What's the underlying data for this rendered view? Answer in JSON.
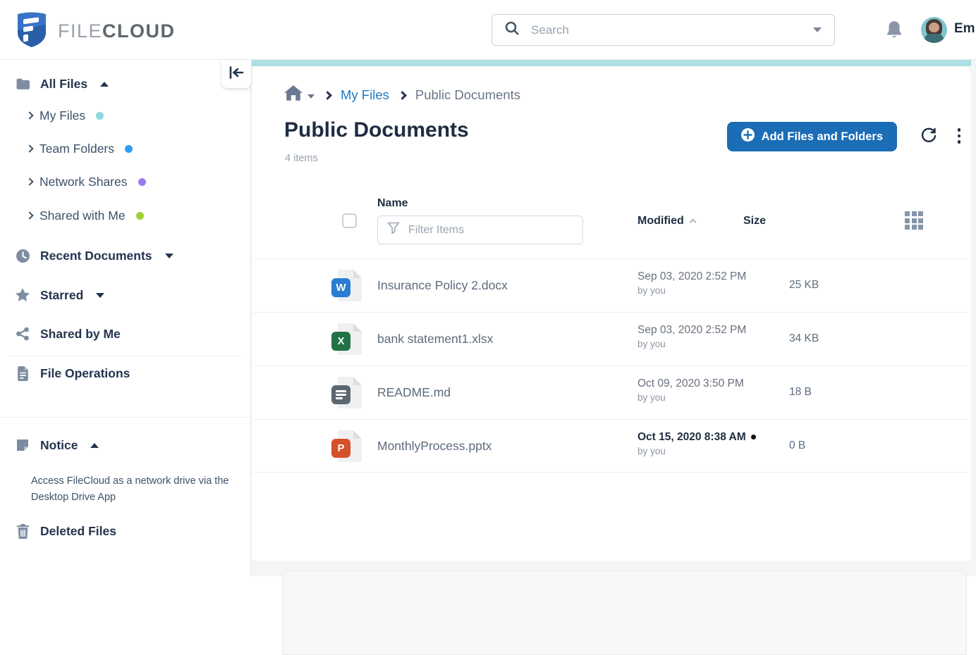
{
  "brand": {
    "file": "FILE",
    "cloud": "CLOUD"
  },
  "header": {
    "search_placeholder": "Search",
    "user_name": "Em"
  },
  "sidebar": {
    "all_files": "All Files",
    "sub_items": [
      {
        "label": "My Files",
        "dot_color": "#8fd8df"
      },
      {
        "label": "Team Folders",
        "dot_color": "#2d9cf4"
      },
      {
        "label": "Network Shares",
        "dot_color": "#9b79f1"
      },
      {
        "label": "Shared with Me",
        "dot_color": "#a6cd38"
      }
    ],
    "recent_documents": "Recent Documents",
    "starred": "Starred",
    "shared_by_me": "Shared by Me",
    "file_operations": "File Operations",
    "notice": "Notice",
    "notice_text": "Access FileCloud as a network drive via the Desktop Drive App",
    "deleted_files": "Deleted Files"
  },
  "breadcrumb": {
    "my_files": "My Files",
    "current": "Public Documents"
  },
  "page": {
    "title": "Public Documents",
    "item_count": "4 items",
    "add_button": "Add Files and Folders"
  },
  "table": {
    "name_header": "Name",
    "filter_placeholder": "Filter Items",
    "modified_header": "Modified",
    "size_header": "Size",
    "rows": [
      {
        "name": "Insurance Policy 2.docx",
        "file_type": "word",
        "badge_letter": "W",
        "badge_color": "#2b7cd3",
        "modified_date": "Sep 03, 2020 2:52 PM",
        "modified_by": "by you",
        "size": "25 KB"
      },
      {
        "name": "bank statement1.xlsx",
        "file_type": "excel",
        "badge_letter": "X",
        "badge_color": "#217346",
        "modified_date": "Sep 03, 2020 2:52 PM",
        "modified_by": "by you",
        "size": "34 KB"
      },
      {
        "name": "README.md",
        "file_type": "markdown",
        "badge_letter": "",
        "badge_color": "#5d6772",
        "modified_date": "Oct 09, 2020 3:50 PM",
        "modified_by": "by you",
        "size": "18 B"
      },
      {
        "name": "MonthlyProcess.pptx",
        "file_type": "powerpoint",
        "badge_letter": "P",
        "badge_color": "#d6502b",
        "modified_date": "Oct 15, 2020 8:38 AM",
        "modified_by": "by you",
        "size": "0 B",
        "recent": true
      }
    ]
  },
  "colors": {
    "accent_blue": "#1b6db6",
    "link_blue": "#2079c0",
    "teal_bar": "#aee0e3",
    "navy_text": "#24344f"
  }
}
